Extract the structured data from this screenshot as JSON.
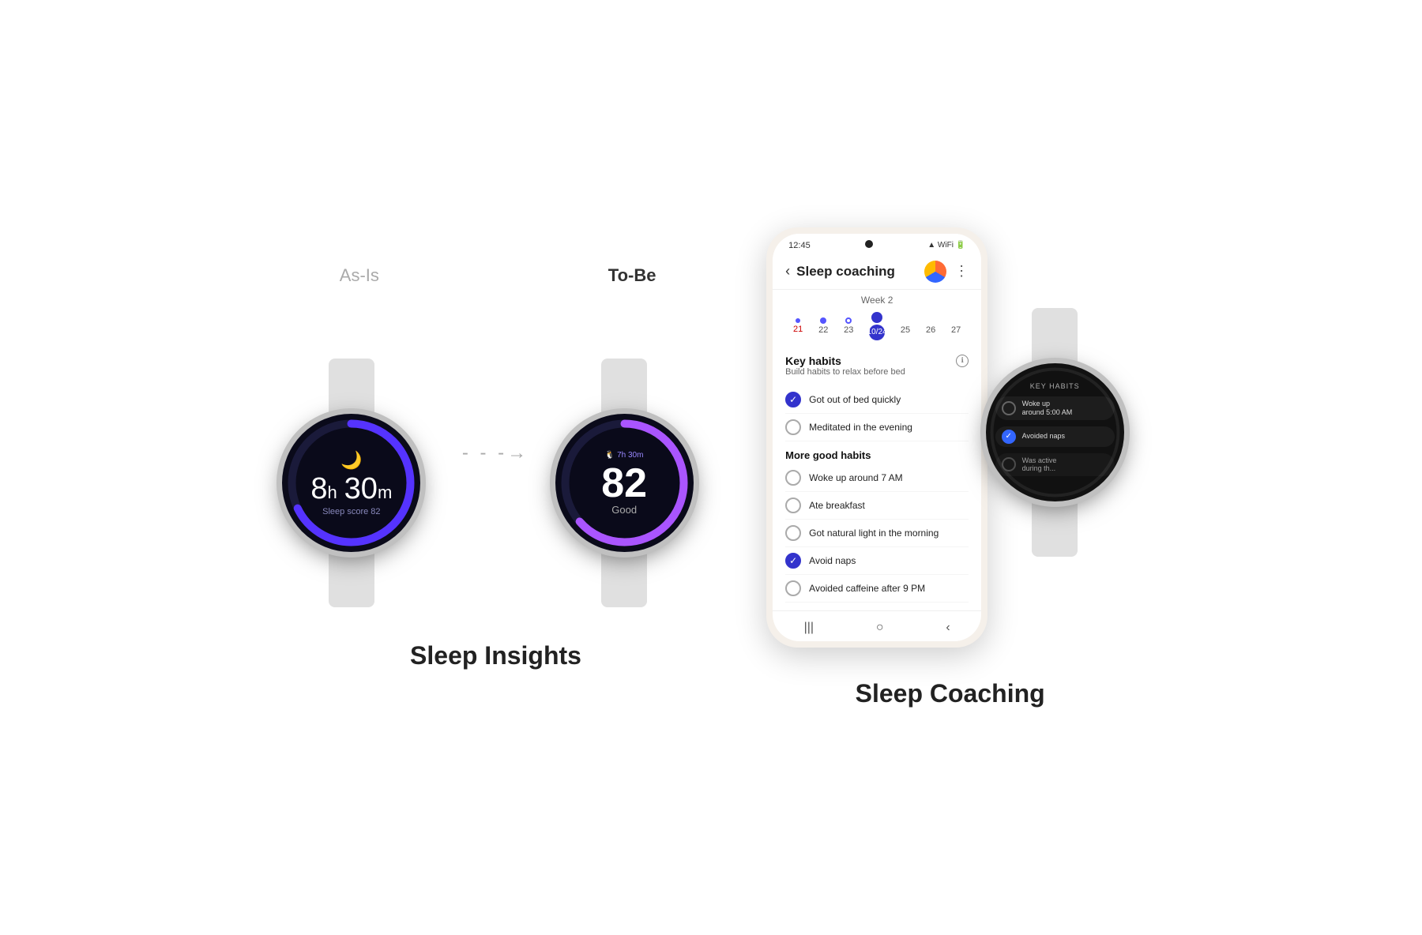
{
  "page": {
    "background": "#ffffff"
  },
  "sleep_insights": {
    "section_title": "Sleep Insights",
    "as_is_label": "As-Is",
    "to_be_label": "To-Be",
    "watch1": {
      "time_display": "8h 30m",
      "time_unit_h": "h",
      "time_unit_m": "m",
      "score_label": "Sleep score 82",
      "score_value": "82",
      "ring_color": "#5555ff"
    },
    "watch2": {
      "time_header": "7h 30m",
      "score_big": "82",
      "score_label": "Good",
      "ring_color": "#8855ff"
    }
  },
  "sleep_coaching": {
    "section_title": "Sleep Coaching",
    "phone": {
      "status_time": "12:45",
      "header_title": "Sleep coaching",
      "back_label": "‹",
      "week_label": "Week 2",
      "calendar_days": [
        {
          "num": "21",
          "style": "red",
          "dot": "small"
        },
        {
          "num": "22",
          "style": "normal",
          "dot": "medium"
        },
        {
          "num": "23",
          "style": "normal",
          "dot": "outline"
        },
        {
          "num": "10/24",
          "style": "active",
          "dot": "large"
        },
        {
          "num": "25",
          "style": "normal",
          "dot": "empty"
        },
        {
          "num": "26",
          "style": "normal",
          "dot": "empty"
        },
        {
          "num": "27",
          "style": "normal",
          "dot": "empty"
        }
      ],
      "key_habits_title": "Key habits",
      "key_habits_subtitle": "Build habits to relax before bed",
      "key_habits": [
        {
          "text": "Got out of bed quickly",
          "checked": true
        },
        {
          "text": "Meditated in the evening",
          "checked": false
        }
      ],
      "more_habits_title": "More good habits",
      "more_habits": [
        {
          "text": "Woke up around 7 AM",
          "checked": false
        },
        {
          "text": "Ate breakfast",
          "checked": false
        },
        {
          "text": "Got natural light in the morning",
          "checked": false
        },
        {
          "text": "Avoid naps",
          "checked": true
        },
        {
          "text": "Avoided caffeine after 9 PM",
          "checked": false
        }
      ],
      "nav_items": [
        "|||",
        "○",
        "‹"
      ]
    },
    "watch": {
      "key_habits_label": "Key habits",
      "habits": [
        {
          "text": "Woke up\naround 5:00 AM",
          "checked": false
        },
        {
          "text": "Avoided naps",
          "checked": true
        },
        {
          "text": "Was active\nduring th...",
          "checked": false
        }
      ]
    }
  }
}
